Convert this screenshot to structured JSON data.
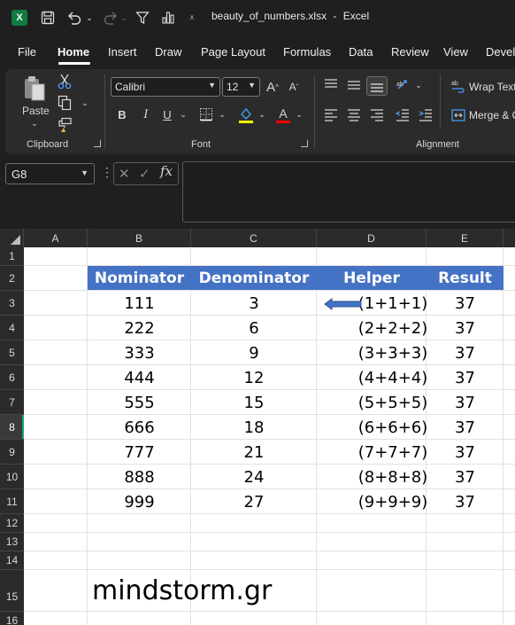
{
  "app": {
    "filename": "beauty_of_numbers.xlsx",
    "app_name": "Excel",
    "title_separator": "-",
    "logo_letter": "X"
  },
  "menu": {
    "tabs": [
      "File",
      "Home",
      "Insert",
      "Draw",
      "Page Layout",
      "Formulas",
      "Data",
      "Review",
      "View",
      "Devel"
    ],
    "active": "Home"
  },
  "ribbon": {
    "clipboard": {
      "label": "Clipboard",
      "paste_label": "Paste"
    },
    "font": {
      "label": "Font",
      "font_name": "Calibri",
      "font_size": "12",
      "bold": "B",
      "italic": "I",
      "underline": "U",
      "grow": "A",
      "shrink": "A",
      "font_color_letter": "A"
    },
    "alignment": {
      "label": "Alignment",
      "wrap_text": "Wrap Text",
      "merge": "Merge & C"
    },
    "colors": {
      "accent": "#107c41",
      "fill_bar": "#ffff00",
      "font_bar": "#ff0000"
    }
  },
  "formula_bar": {
    "name_box": "G8",
    "fx": "fx",
    "value": ""
  },
  "sheet": {
    "columns": [
      "A",
      "B",
      "C",
      "D",
      "E"
    ],
    "rows": [
      "1",
      "2",
      "3",
      "4",
      "5",
      "6",
      "7",
      "8",
      "9",
      "10",
      "11",
      "12",
      "13",
      "14",
      "15",
      "16"
    ],
    "selected_row": "8",
    "header": {
      "b": "Nominator",
      "c": "Denominator",
      "d": "Helper",
      "e": "Result"
    },
    "header_color": "#4472c4",
    "data": [
      {
        "b": "111",
        "c": "3",
        "d": "(1+1+1)",
        "e": "37"
      },
      {
        "b": "222",
        "c": "6",
        "d": "(2+2+2)",
        "e": "37"
      },
      {
        "b": "333",
        "c": "9",
        "d": "(3+3+3)",
        "e": "37"
      },
      {
        "b": "444",
        "c": "12",
        "d": "(4+4+4)",
        "e": "37"
      },
      {
        "b": "555",
        "c": "15",
        "d": "(5+5+5)",
        "e": "37"
      },
      {
        "b": "666",
        "c": "18",
        "d": "(6+6+6)",
        "e": "37"
      },
      {
        "b": "777",
        "c": "21",
        "d": "(7+7+7)",
        "e": "37"
      },
      {
        "b": "888",
        "c": "24",
        "d": "(8+8+8)",
        "e": "37"
      },
      {
        "b": "999",
        "c": "27",
        "d": "(9+9+9)",
        "e": "37"
      }
    ],
    "brand_text": "mindstorm.gr",
    "arrow_color": "#4472c4"
  }
}
